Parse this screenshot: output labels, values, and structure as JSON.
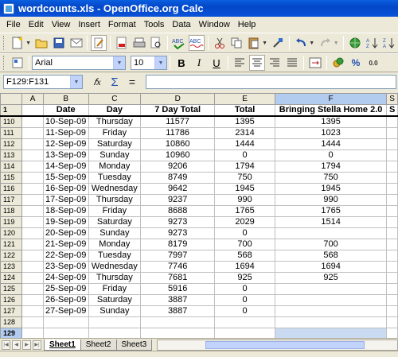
{
  "window": {
    "title": "wordcounts.xls - OpenOffice.org Calc"
  },
  "menu": [
    "File",
    "Edit",
    "View",
    "Insert",
    "Format",
    "Tools",
    "Data",
    "Window",
    "Help"
  ],
  "format_toolbar": {
    "font": "Arial",
    "size": "10"
  },
  "formula_bar": {
    "name_box": "F129:F131",
    "fx": "𝑓x",
    "sum": "Σ",
    "equals": "=",
    "content": ""
  },
  "columns": [
    "",
    "A",
    "B",
    "C",
    "D",
    "E",
    "F",
    "S"
  ],
  "header_row": {
    "num": "1",
    "cells": [
      "",
      "Date",
      "Day",
      "7 Day Total",
      "Total",
      "Bringing Stella Home 2.0",
      "S"
    ]
  },
  "rows": [
    {
      "num": "110",
      "cells": [
        "",
        "10-Sep-09",
        "Thursday",
        "11577",
        "1395",
        "1395",
        ""
      ]
    },
    {
      "num": "111",
      "cells": [
        "",
        "11-Sep-09",
        "Friday",
        "11786",
        "2314",
        "1023",
        ""
      ]
    },
    {
      "num": "112",
      "cells": [
        "",
        "12-Sep-09",
        "Saturday",
        "10860",
        "1444",
        "1444",
        ""
      ]
    },
    {
      "num": "113",
      "cells": [
        "",
        "13-Sep-09",
        "Sunday",
        "10960",
        "0",
        "0",
        ""
      ]
    },
    {
      "num": "114",
      "cells": [
        "",
        "14-Sep-09",
        "Monday",
        "9206",
        "1794",
        "1794",
        ""
      ]
    },
    {
      "num": "115",
      "cells": [
        "",
        "15-Sep-09",
        "Tuesday",
        "8749",
        "750",
        "750",
        ""
      ]
    },
    {
      "num": "116",
      "cells": [
        "",
        "16-Sep-09",
        "Wednesday",
        "9642",
        "1945",
        "1945",
        ""
      ]
    },
    {
      "num": "117",
      "cells": [
        "",
        "17-Sep-09",
        "Thursday",
        "9237",
        "990",
        "990",
        ""
      ]
    },
    {
      "num": "118",
      "cells": [
        "",
        "18-Sep-09",
        "Friday",
        "8688",
        "1765",
        "1765",
        ""
      ]
    },
    {
      "num": "119",
      "cells": [
        "",
        "19-Sep-09",
        "Saturday",
        "9273",
        "2029",
        "1514",
        ""
      ]
    },
    {
      "num": "120",
      "cells": [
        "",
        "20-Sep-09",
        "Sunday",
        "9273",
        "0",
        "",
        ""
      ]
    },
    {
      "num": "121",
      "cells": [
        "",
        "21-Sep-09",
        "Monday",
        "8179",
        "700",
        "700",
        ""
      ]
    },
    {
      "num": "122",
      "cells": [
        "",
        "22-Sep-09",
        "Tuesday",
        "7997",
        "568",
        "568",
        ""
      ]
    },
    {
      "num": "123",
      "cells": [
        "",
        "23-Sep-09",
        "Wednesday",
        "7746",
        "1694",
        "1694",
        ""
      ]
    },
    {
      "num": "124",
      "cells": [
        "",
        "24-Sep-09",
        "Thursday",
        "7681",
        "925",
        "925",
        ""
      ]
    },
    {
      "num": "125",
      "cells": [
        "",
        "25-Sep-09",
        "Friday",
        "5916",
        "0",
        "",
        ""
      ]
    },
    {
      "num": "126",
      "cells": [
        "",
        "26-Sep-09",
        "Saturday",
        "3887",
        "0",
        "",
        ""
      ]
    },
    {
      "num": "127",
      "cells": [
        "",
        "27-Sep-09",
        "Sunday",
        "3887",
        "0",
        "",
        ""
      ]
    },
    {
      "num": "128",
      "cells": [
        "",
        "",
        "",
        "",
        "",
        "",
        ""
      ]
    },
    {
      "num": "129",
      "cells": [
        "",
        "",
        "",
        "",
        "",
        "",
        ""
      ],
      "selected": true
    }
  ],
  "sheets": [
    "Sheet1",
    "Sheet2",
    "Sheet3"
  ],
  "active_sheet": "Sheet1",
  "colors": {
    "title_bar": "#0347C8",
    "selection": "#C9DAF1",
    "chrome": "#ECE9D8"
  }
}
